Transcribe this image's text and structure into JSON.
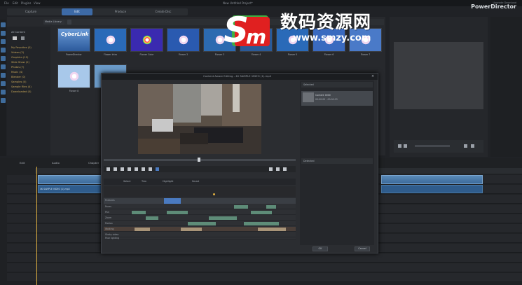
{
  "window": {
    "title": "New Untitled Project*"
  },
  "menu": {
    "items": [
      "File",
      "Edit",
      "Plugins",
      "View"
    ]
  },
  "brand": {
    "subtitle": "Upgrade Download",
    "name": "PowerDirector"
  },
  "mode_tabs": [
    {
      "label": "Capture"
    },
    {
      "label": "Edit",
      "active": true
    },
    {
      "label": "Produce"
    },
    {
      "label": "Create Disc"
    }
  ],
  "library": {
    "tree_header": "All Content",
    "tree_items": [
      "My Favorites (0)",
      "Videos (2)",
      "Graphics (12)",
      "Slide Show (0)",
      "Photos (7)",
      "Music (4)",
      "Blender (0)",
      "Samples (0)",
      "Sample Files (4)",
      "Downloaded (0)"
    ],
    "filter_label": "Media Library",
    "thumbs": [
      {
        "label": "PowerDirector",
        "kind": "logo",
        "caption": "CyberLink"
      },
      {
        "label": "Flower Intro",
        "kind": "flower"
      },
      {
        "label": "Flower Color",
        "kind": "rainbow"
      },
      {
        "label": "Flower 2",
        "kind": "flower"
      },
      {
        "label": "Flower 3",
        "kind": "flower"
      },
      {
        "label": "Flower 4",
        "kind": "flower"
      },
      {
        "label": "Flower 5",
        "kind": "flower"
      },
      {
        "label": "Flower 6",
        "kind": "flower"
      },
      {
        "label": "Flower 7",
        "kind": "flower"
      },
      {
        "label": "Flower 8",
        "kind": "flower"
      }
    ]
  },
  "dialog": {
    "title": "Content Aware Editing - 4K SAMPLE VIDEO (1).mp4",
    "right_header": "Selected",
    "item_title": "Content 0000",
    "item_sub": "00:00:00 - 00:00:15",
    "right_header2": "Detected",
    "tools": [
      "Select",
      "Trim",
      "Highlight",
      "Smart"
    ],
    "grid_header": "Features",
    "rows": [
      "Faces",
      "Pan",
      "Zoom",
      "Motion",
      "Walking",
      "Shaky video",
      "Poor lighting"
    ],
    "ok": "OK",
    "cancel": "Cancel"
  },
  "timeline": {
    "tabs": [
      "Edit",
      "Audio",
      "Chapter"
    ],
    "clip_label": "4K SAMPLE VIDEO (1).mp4"
  },
  "watermark": {
    "title": "数码资源网",
    "url": "www.smzy.com"
  },
  "colors": {
    "accent": "#3d6aa6",
    "folder": "#c9a85a",
    "playhead": "#e0b040"
  }
}
